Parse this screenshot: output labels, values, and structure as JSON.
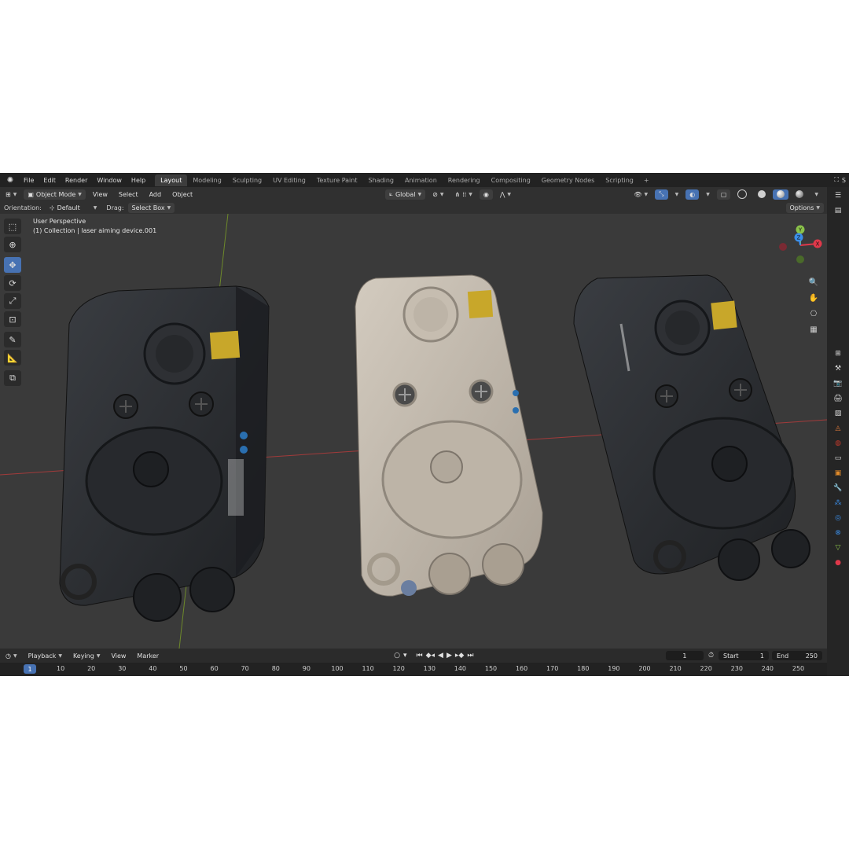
{
  "menubar": {
    "menus": [
      "File",
      "Edit",
      "Render",
      "Window",
      "Help"
    ],
    "workspaces": [
      "Layout",
      "Modeling",
      "Sculpting",
      "UV Editing",
      "Texture Paint",
      "Shading",
      "Animation",
      "Rendering",
      "Compositing",
      "Geometry Nodes",
      "Scripting"
    ],
    "active_workspace": "Layout",
    "scene_initial": "S"
  },
  "header": {
    "mode": "Object Mode",
    "menus": [
      "View",
      "Select",
      "Add",
      "Object"
    ],
    "transform_orientation": "Global"
  },
  "tool_settings": {
    "orientation_label": "Orientation:",
    "orientation_value": "Default",
    "drag_label": "Drag:",
    "drag_value": "Select Box",
    "options": "Options"
  },
  "viewport": {
    "perspective": "User Perspective",
    "collection_info": "(1) Collection | laser aiming device.001",
    "gizmo_axes": [
      "X",
      "Y",
      "Z"
    ]
  },
  "timeline": {
    "menus": [
      "Playback",
      "Keying",
      "View",
      "Marker"
    ],
    "current_frame": "1",
    "start_label": "Start",
    "start_value": "1",
    "end_label": "End",
    "end_value": "250",
    "ruler_marks": [
      "1",
      "10",
      "20",
      "30",
      "40",
      "50",
      "60",
      "70",
      "80",
      "90",
      "100",
      "110",
      "120",
      "130",
      "140",
      "150",
      "160",
      "170",
      "180",
      "190",
      "200",
      "210",
      "220",
      "230",
      "240",
      "250"
    ]
  },
  "colors": {
    "accent": "#4772b3",
    "axis_x": "#e0384a",
    "axis_y": "#8bc34a",
    "axis_z": "#3b8ee8",
    "device_dark": "#2b2d31",
    "device_tan": "#b9afa2"
  }
}
